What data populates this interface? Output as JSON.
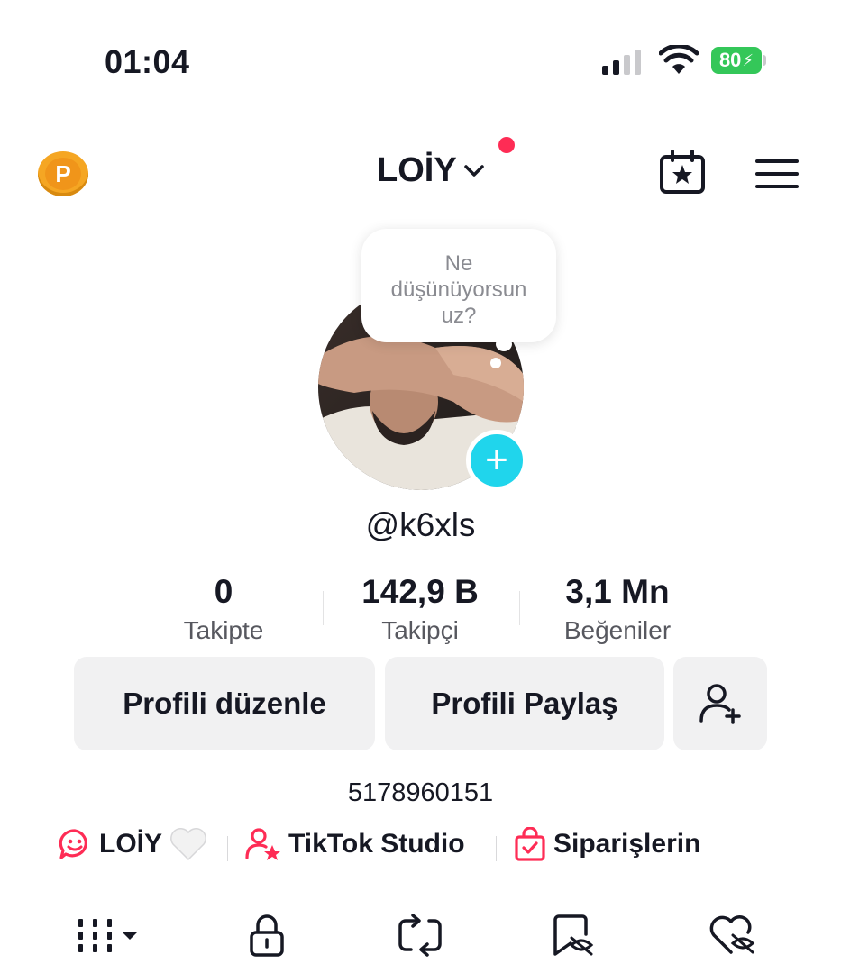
{
  "status_bar": {
    "time": "01:04",
    "battery": "80"
  },
  "header": {
    "coin_letter": "P",
    "account_name": "LOİY"
  },
  "profile": {
    "thought_bubble": [
      "Ne",
      "düşünüyorsun",
      "uz?"
    ],
    "username": "@k6xls"
  },
  "stats": [
    {
      "value": "0",
      "label": "Takipte"
    },
    {
      "value": "142,9 B",
      "label": "Takipçi"
    },
    {
      "value": "3,1 Mn",
      "label": "Beğeniler"
    }
  ],
  "buttons": {
    "edit_profile": "Profili düzenle",
    "share_profile": "Profili Paylaş"
  },
  "bio": "5178960151",
  "links": [
    {
      "label": "LOİY",
      "icon": "smile-chat-icon",
      "suffix_icon": "white-heart-icon"
    },
    {
      "label": "TikTok Studio",
      "icon": "user-star-icon"
    },
    {
      "label": "Siparişlerin",
      "icon": "shopping-bag-icon"
    }
  ],
  "tabs": [
    {
      "icon": "videos-grid-icon",
      "selected": true
    },
    {
      "icon": "lock-icon",
      "selected": false
    },
    {
      "icon": "repost-icon",
      "selected": false
    },
    {
      "icon": "bookmark-hidden-icon",
      "selected": false
    },
    {
      "icon": "liked-hidden-icon",
      "selected": false
    }
  ],
  "colors": {
    "accent": "#fe2c55",
    "badge": "#20d5ec",
    "coin": "#f5a623",
    "battery": "#34c759"
  }
}
